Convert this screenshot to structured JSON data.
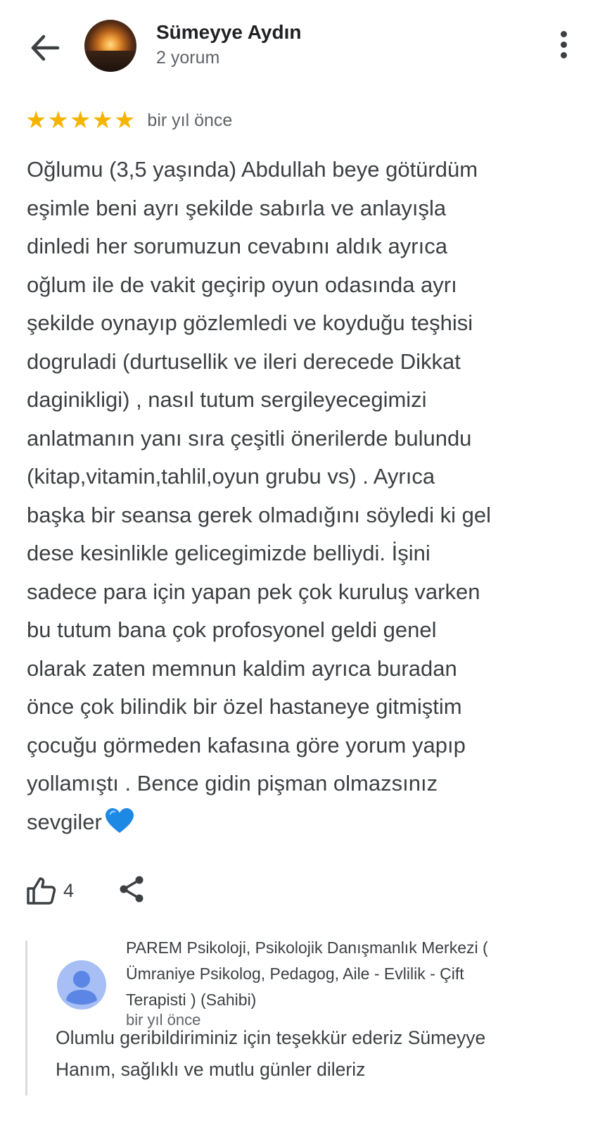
{
  "reviewer": {
    "name": "Sümeyye Aydın",
    "review_count": "2 yorum"
  },
  "review": {
    "rating": 5,
    "rating_max": 5,
    "date": "bir yıl önce",
    "text_lines": [
      "Oğlumu (3,5 yaşında) Abdullah beye götürdüm",
      "eşimle beni ayrı şekilde sabırla ve anlayışla",
      "dinledi her sorumuzun cevabını aldık ayrıca",
      "oğlum ile de vakit geçirip oyun odasında ayrı",
      "şekilde oynayıp gözlemledi ve koyduğu teşhisi",
      "dogruladi (durtusellik ve ileri derecede Dikkat",
      "daginikligi) , nasıl tutum sergileyecegimizi",
      "anlatmanın yanı sıra çeşitli önerilerde bulundu",
      "(kitap,vitamin,tahlil,oyun grubu vs) . Ayrıca",
      "başka bir seansa gerek olmadığını söyledi ki gel",
      "dese kesinlikle gelicegimizde belliydi. İşini",
      "sadece para için yapan pek çok kuruluş varken",
      "bu tutum bana çok profosyonel geldi genel",
      "olarak zaten memnun kaldim ayrıca buradan",
      "önce çok bilindik bir özel hastaneye gitmiştim",
      "çocuğu görmeden kafasına göre yorum yapıp",
      "yollamıştı . Bence gidin pişman olmazsınız",
      "sevgiler"
    ],
    "emoji": "blue-heart",
    "like_count": "4"
  },
  "owner_reply": {
    "name_lines": [
      "PAREM Psikoloji, Psikolojik Danışmanlık Merkezi (",
      "Ümraniye Psikolog, Pedagog, Aile - Evlilik - Çift",
      "Terapisti ) (Sahibi)"
    ],
    "date": "bir yıl önce",
    "text_lines": [
      "Olumlu geribildiriminiz için teşekkür ederiz Sümeyye",
      "Hanım, sağlıklı ve mutlu günler dileriz"
    ]
  },
  "colors": {
    "star": "#f4b400",
    "heart": "#1e88e5",
    "owner_avatar_bg": "#a7bff5",
    "owner_avatar_fg": "#5b86e5"
  },
  "icons": {
    "back": "arrow-left-icon",
    "more": "more-vertical-icon",
    "like": "thumbs-up-icon",
    "share": "share-icon"
  }
}
